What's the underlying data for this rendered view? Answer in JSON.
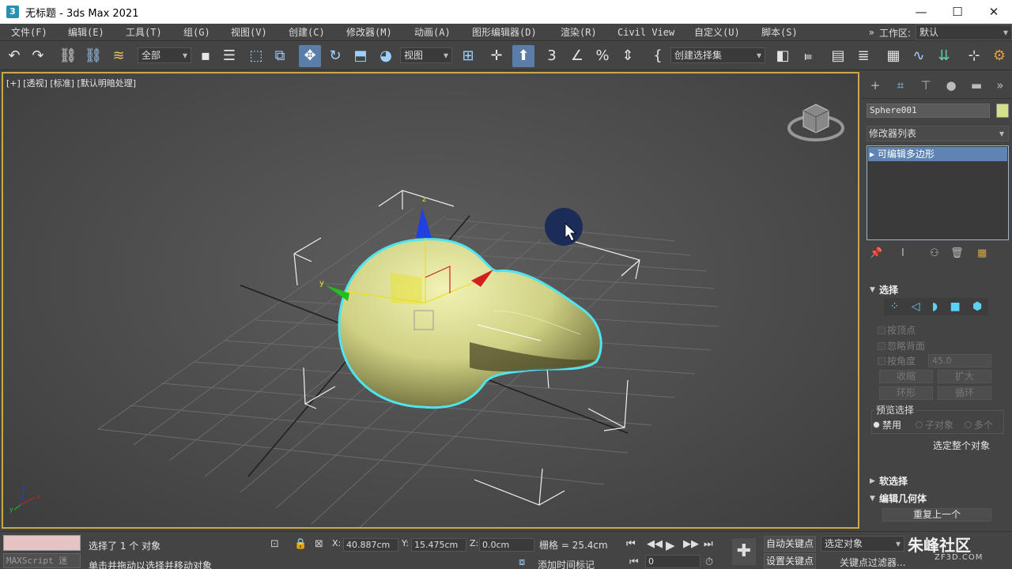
{
  "titlebar": {
    "app_icon": "3",
    "title": "无标题 - 3ds Max 2021",
    "controls": {
      "minimize": "—",
      "maximize": "☐",
      "close": "✕"
    }
  },
  "menu": {
    "items": [
      "文件(F)",
      "编辑(E)",
      "工具(T)",
      "组(G)",
      "视图(V)",
      "创建(C)",
      "修改器(M)",
      "动画(A)",
      "图形编辑器(D)",
      "渲染(R)",
      "Civil View",
      "自定义(U)",
      "脚本(S)"
    ],
    "overflow": "»",
    "workspace_label": "工作区:",
    "workspace_value": "默认"
  },
  "toolbar": {
    "selection_filter": "全部",
    "ref_coord": "视图",
    "named_selection": "创建选择集",
    "icons": [
      "undo-icon",
      "redo-icon",
      "link-icon",
      "unlink-icon",
      "bind-spacewarp-icon",
      "select-object-icon",
      "select-by-name-icon",
      "rect-region-icon",
      "window-crossing-icon",
      "move-icon",
      "rotate-icon",
      "scale-icon",
      "place-icon",
      "pivot-icon",
      "snap-icon",
      "angle-snap-icon",
      "percent-snap-icon",
      "spinner-snap-icon",
      "edit-named-sel-icon",
      "mirror-icon",
      "align-icon",
      "scene-explorer-icon",
      "layer-icon",
      "ribbon-icon",
      "curve-editor-icon",
      "schematic-icon",
      "material-icon",
      "render-setup-icon"
    ]
  },
  "viewport": {
    "label": "[+] [透视] [标准] [默认明暗处理]",
    "gizmo_axes": {
      "x": "x",
      "y": "y",
      "z": "z"
    }
  },
  "command_panel": {
    "object_name": "Sphere001",
    "object_color": "#d2e28a",
    "modifier_list": "修改器列表",
    "stack_item": "可编辑多边形",
    "selection_rollout": {
      "title": "选择",
      "by_vertex": "按顶点",
      "ignore_backfacing": "忽略背面",
      "by_angle": "按角度",
      "angle_value": "45.0",
      "shrink": "收缩",
      "grow": "扩大",
      "ring": "环形",
      "loop": "循环",
      "preview_title": "预览选择",
      "preview_off": "禁用",
      "preview_subobj": "子对象",
      "preview_multi": "多个",
      "select_whole": "选定整个对象"
    },
    "soft_selection": "软选择",
    "edit_geometry": "编辑几何体",
    "repeat_last": "重复上一个"
  },
  "statusbar": {
    "maxscript": "MAXScript 迷",
    "status_line1": "选择了 1 个 对象",
    "status_line2": "单击并拖动以选择并移动对象",
    "x_label": "X:",
    "x_value": "40.887cm",
    "y_label": "Y:",
    "y_value": "15.475cm",
    "z_label": "Z:",
    "z_value": "0.0cm",
    "grid": "栅格 = 25.4cm",
    "add_time_tag": "添加时间标记",
    "auto_key": "自动关键点",
    "set_key": "设置关键点",
    "selected_obj": "选定对象",
    "key_filters": "关键点过滤器...",
    "frame": "0"
  },
  "watermark": {
    "text": "朱峰社区",
    "sub": "ZF3D.COM"
  }
}
